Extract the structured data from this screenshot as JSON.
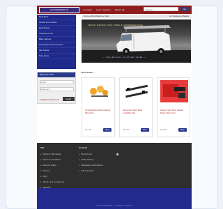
{
  "header": {
    "logo_text": "AUTOMARKET UK",
    "links": [
      "▸ Contact",
      "Login / Register",
      "Basket (0)"
    ],
    "search_placeholder": "Search...",
    "search_button": "Go"
  },
  "sidebar": {
    "items": [
      "Roof Bars",
      "Ladder Roof Racks",
      "Roof Boxes",
      "Towbars & Kits",
      "Bike Carriers",
      "Load Stops & Accessories",
      "Van Racks",
      "Sale Items"
    ]
  },
  "login": {
    "title": "Welcome back",
    "email_placeholder": "Email",
    "password_placeholder": "Password",
    "forgot": "Forgotten password?",
    "button": "Login"
  },
  "breadcrumb": {
    "left": "Home ▸ Roof Racks ▸ Vans",
    "right": "▸ Checkout ▸ Basket"
  },
  "hero": {
    "caption": "ROOF RACKS FOR VANS & COMMERCIALS",
    "bottom_caption": "— free delivery on all van racks —"
  },
  "section": {
    "title": "Best Sellers"
  },
  "products": [
    {
      "name": "Universal Roof Bar Clamps Fitting Kit",
      "price_old": "£34.99",
      "add": "Buy",
      "img_color": "#f4a226"
    },
    {
      "name": "Aluminium Roof Bars Lockable Pair",
      "price_old": "£89.99",
      "add": "Buy",
      "img_color": "#2a2a2a"
    },
    {
      "name": "Heavy Duty Steel Ladder Rack Clamp Set",
      "price_old": "£59.99",
      "add": "Buy",
      "img_color": "#c81e1e"
    }
  ],
  "footer": {
    "col1": {
      "title": "Info",
      "links": [
        "Delivery Information",
        "Terms & Conditions",
        "Returns Policy",
        "Privacy",
        "FAQ",
        "About us & Contact Us",
        "Sitemap"
      ]
    },
    "col2": {
      "title": "Account",
      "links": [
        "My Account",
        "Order History",
        "Newsletter Subscription",
        "Gift Vouchers"
      ]
    }
  },
  "bottombar": {
    "copyright": "© Automarket UK — All rights reserved"
  }
}
